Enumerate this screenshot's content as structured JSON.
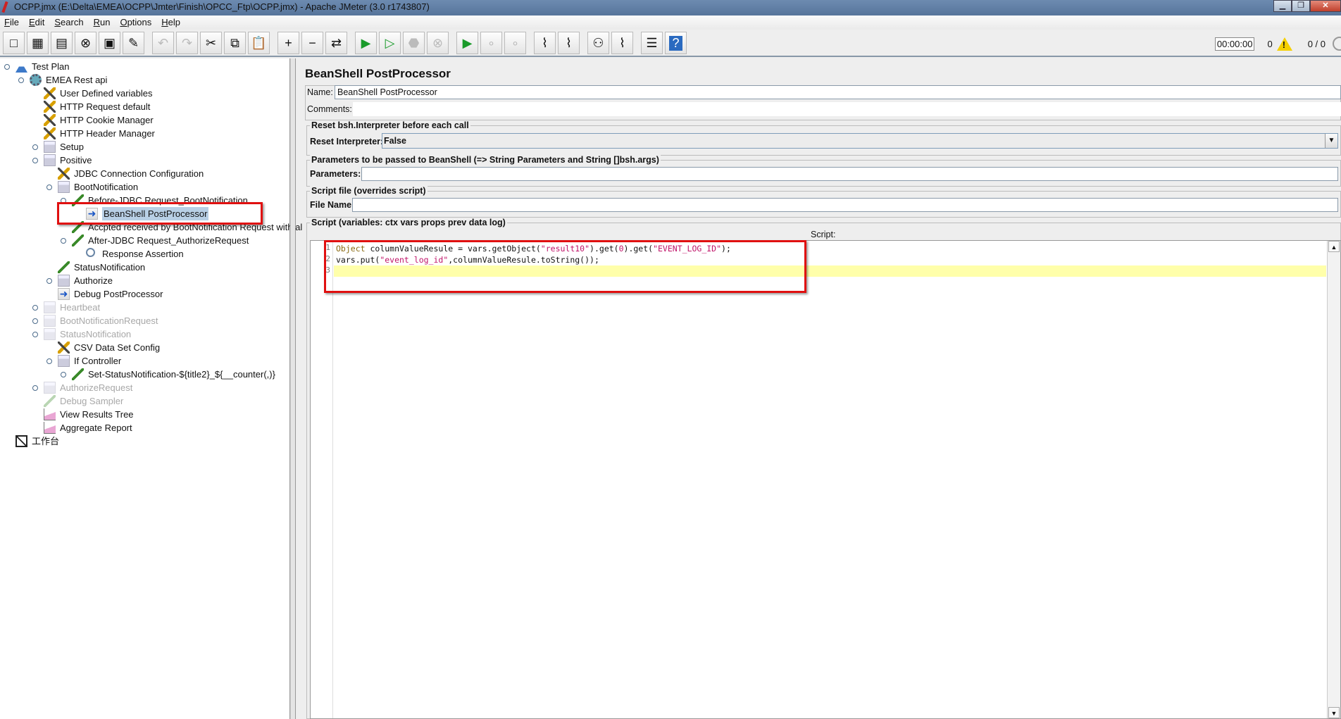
{
  "window": {
    "title": "OCPP.jmx (E:\\Delta\\EMEA\\OCPP\\Jmter\\Finish\\OPCC_Ftp\\OCPP.jmx) - Apache JMeter (3.0 r1743807)"
  },
  "menu": [
    "File",
    "Edit",
    "Search",
    "Run",
    "Options",
    "Help"
  ],
  "toolbar": [
    {
      "icon": "new-icon",
      "g": "□"
    },
    {
      "icon": "templates-icon",
      "g": "▦"
    },
    {
      "icon": "open-icon",
      "g": "▤"
    },
    {
      "icon": "close-icon",
      "g": "⊗"
    },
    {
      "icon": "save-icon",
      "g": "▣"
    },
    {
      "icon": "save-as-icon",
      "g": "✎"
    },
    {
      "icon": "undo-icon",
      "g": "↶",
      "dis": true,
      "gap": true
    },
    {
      "icon": "redo-icon",
      "g": "↷",
      "dis": true
    },
    {
      "icon": "cut-icon",
      "g": "✂"
    },
    {
      "icon": "copy-icon",
      "g": "⧉"
    },
    {
      "icon": "paste-icon",
      "g": "📋"
    },
    {
      "icon": "expand-icon",
      "g": "+",
      "gap": true
    },
    {
      "icon": "collapse-icon",
      "g": "−"
    },
    {
      "icon": "toggle-icon",
      "g": "⇄"
    },
    {
      "icon": "start-icon",
      "g": "▶",
      "gap": true
    },
    {
      "icon": "start-no-pause-icon",
      "g": "▷"
    },
    {
      "icon": "stop-icon",
      "g": "⬣",
      "dis": true
    },
    {
      "icon": "shutdown-icon",
      "g": "⊗",
      "dis": true
    },
    {
      "icon": "remote-start-icon",
      "g": "▶",
      "gap": true
    },
    {
      "icon": "remote-stop-icon",
      "g": "∘",
      "dis": true
    },
    {
      "icon": "remote-shutdown-icon",
      "g": "∘",
      "dis": true
    },
    {
      "icon": "clear-icon",
      "g": "⌇",
      "gap": true
    },
    {
      "icon": "clear-all-icon",
      "g": "⌇"
    },
    {
      "icon": "search-binoculars-icon",
      "g": "⚇",
      "gap": true
    },
    {
      "icon": "reset-search-broom-icon",
      "g": "⌇"
    },
    {
      "icon": "function-helper-icon",
      "g": "☰",
      "gap": true
    },
    {
      "icon": "help-icon",
      "g": "?"
    }
  ],
  "status": {
    "timer": "00:00:00",
    "warnings": "0",
    "threads": "0 / 0"
  },
  "tree": [
    {
      "label": "Test Plan",
      "level": 0,
      "icon": "plan",
      "exp": true
    },
    {
      "label": "EMEA Rest api",
      "level": 1,
      "icon": "gear",
      "exp": true
    },
    {
      "label": "User Defined variables",
      "level": 2,
      "icon": "config"
    },
    {
      "label": "HTTP Request  default",
      "level": 2,
      "icon": "config"
    },
    {
      "label": "HTTP Cookie Manager",
      "level": 2,
      "icon": "config"
    },
    {
      "label": "HTTP Header Manager",
      "level": 2,
      "icon": "config"
    },
    {
      "label": "Setup",
      "level": 2,
      "icon": "thread",
      "exp": true
    },
    {
      "label": "Positive",
      "level": 2,
      "icon": "thread",
      "exp": true
    },
    {
      "label": "JDBC Connection Configuration",
      "level": 3,
      "icon": "config"
    },
    {
      "label": "BootNotification",
      "level": 3,
      "icon": "thread",
      "exp": true
    },
    {
      "label": "Before-JDBC Request_BootNotification",
      "level": 4,
      "icon": "sampler",
      "exp": true
    },
    {
      "label": "BeanShell PostProcessor",
      "level": 5,
      "icon": "post",
      "selected": true
    },
    {
      "label": "Accpted received by BootNotification Request with al",
      "level": 4,
      "icon": "sampler"
    },
    {
      "label": "After-JDBC Request_AuthorizeRequest",
      "level": 4,
      "icon": "sampler",
      "exp": true
    },
    {
      "label": "Response Assertion",
      "level": 5,
      "icon": "assert"
    },
    {
      "label": "StatusNotification",
      "level": 3,
      "icon": "sampler"
    },
    {
      "label": "Authorize",
      "level": 3,
      "icon": "thread",
      "exp": true
    },
    {
      "label": "Debug PostProcessor",
      "level": 3,
      "icon": "post"
    },
    {
      "label": "Heartbeat",
      "level": 2,
      "icon": "thread",
      "exp": true,
      "disabled": true
    },
    {
      "label": "BootNotificationRequest",
      "level": 2,
      "icon": "thread",
      "exp": true,
      "disabled": true
    },
    {
      "label": "StatusNotification",
      "level": 2,
      "icon": "thread",
      "exp": true,
      "disabled": true
    },
    {
      "label": "CSV Data Set Config",
      "level": 3,
      "icon": "config"
    },
    {
      "label": "If Controller",
      "level": 3,
      "icon": "thread",
      "exp": true
    },
    {
      "label": "Set-StatusNotification-${title2}_${__counter(,)}",
      "level": 4,
      "icon": "sampler",
      "exp": true
    },
    {
      "label": "AuthorizeRequest",
      "level": 2,
      "icon": "thread",
      "exp": true,
      "disabled": true
    },
    {
      "label": "Debug Sampler",
      "level": 2,
      "icon": "sampler",
      "disabled": true
    },
    {
      "label": "View Results Tree",
      "level": 2,
      "icon": "listener"
    },
    {
      "label": "Aggregate Report",
      "level": 2,
      "icon": "listener"
    },
    {
      "label": "工作台",
      "level": 0,
      "icon": "work"
    }
  ],
  "panel": {
    "title": "BeanShell PostProcessor",
    "name_label": "Name:",
    "name_value": "BeanShell PostProcessor",
    "comments_label": "Comments:",
    "comments_value": "",
    "reset_group": "Reset bsh.Interpreter before each call",
    "reset_label": "Reset Interpreter:",
    "reset_value": "False",
    "params_group": "Parameters to be passed to BeanShell (=> String Parameters and String []bsh.args)",
    "params_label": "Parameters:",
    "params_value": "",
    "file_group": "Script file (overrides script)",
    "file_label": "File Name:",
    "file_value": "",
    "script_group": "Script (variables: ctx vars props prev data log)",
    "script_label": "Script:",
    "script_lines": [
      "Object columnValueResule = vars.getObject(\"result10\").get(0).get(\"EVENT_LOG_ID\");",
      "vars.put(\"event_log_id\",columnValueResule.toString());",
      ""
    ]
  },
  "colors": {
    "highlight_box": "#e01010",
    "current_line": "#ffffaa",
    "selection": "#b8cfe5"
  }
}
